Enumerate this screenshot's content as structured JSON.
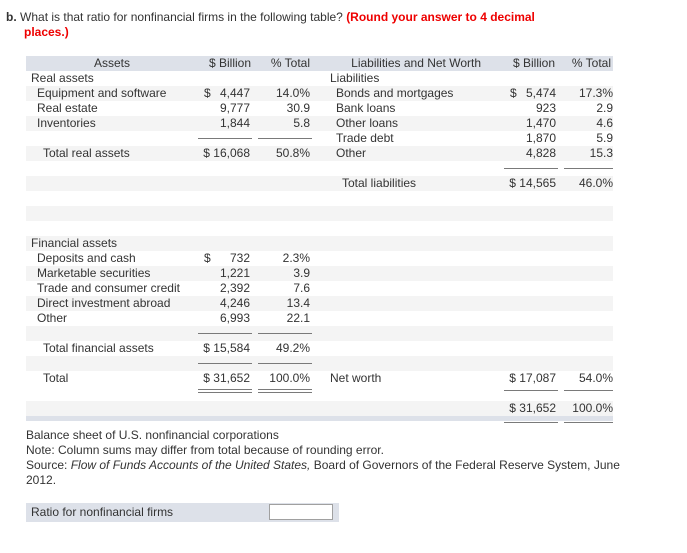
{
  "question": {
    "number": "b.",
    "text": "What is that ratio for nonfinancial firms in the following table?",
    "hint_line1": "(Round your answer to 4 decimal",
    "hint_line2": "places.)"
  },
  "table": {
    "headers": {
      "assets": "Assets",
      "assets_billion": "$ Billion",
      "assets_pct": "% Total",
      "liabilities": "Liabilities and Net Worth",
      "liab_billion": "$ Billion",
      "liab_pct": "% Total"
    },
    "real_assets": {
      "title": "Real assets",
      "items": [
        {
          "label": "Equipment and software",
          "dollar": "$",
          "value": "4,447",
          "pct": "14.0%"
        },
        {
          "label": "Real estate",
          "dollar": "",
          "value": "9,777",
          "pct": "30.9"
        },
        {
          "label": "Inventories",
          "dollar": "",
          "value": "1,844",
          "pct": "5.8"
        }
      ],
      "total": {
        "label": "Total real assets",
        "value": "$ 16,068",
        "pct": "50.8%"
      }
    },
    "liabilities": {
      "title": "Liabilities",
      "items": [
        {
          "label": "Bonds and mortgages",
          "dollar": "$",
          "value": "5,474",
          "pct": "17.3%"
        },
        {
          "label": "Bank loans",
          "dollar": "",
          "value": "923",
          "pct": "2.9"
        },
        {
          "label": "Other loans",
          "dollar": "",
          "value": "1,470",
          "pct": "4.6"
        },
        {
          "label": "Trade debt",
          "dollar": "",
          "value": "1,870",
          "pct": "5.9"
        },
        {
          "label": "Other",
          "dollar": "",
          "value": "4,828",
          "pct": "15.3"
        }
      ],
      "total": {
        "label": "Total liabilities",
        "value": "$ 14,565",
        "pct": "46.0%"
      }
    },
    "financial_assets": {
      "title": "Financial assets",
      "items": [
        {
          "label": "Deposits and cash",
          "dollar": "$",
          "value": "732",
          "pct": "2.3%"
        },
        {
          "label": "Marketable securities",
          "dollar": "",
          "value": "1,221",
          "pct": "3.9"
        },
        {
          "label": "Trade and consumer credit",
          "dollar": "",
          "value": "2,392",
          "pct": "7.6"
        },
        {
          "label": "Direct investment abroad",
          "dollar": "",
          "value": "4,246",
          "pct": "13.4"
        },
        {
          "label": "Other",
          "dollar": "",
          "value": "6,993",
          "pct": "22.1"
        }
      ],
      "total": {
        "label": "Total financial assets",
        "value": "$ 15,584",
        "pct": "49.2%"
      }
    },
    "total_assets": {
      "label": "Total",
      "value": "$ 31,652",
      "pct": "100.0%"
    },
    "net_worth": {
      "label": "Net worth",
      "value": "$ 17,087",
      "pct": "54.0%"
    },
    "total_liab_nw": {
      "value": "$ 31,652",
      "pct": "100.0%"
    }
  },
  "notes": {
    "caption": "Balance sheet of U.S. nonfinancial corporations",
    "note": "Note: Column sums may differ from total because of rounding error.",
    "source_prefix": "Source: ",
    "source_title": "Flow of Funds Accounts of the United States,",
    "source_rest": " Board of Governors of the Federal Reserve System, June 2012."
  },
  "answer": {
    "label": "Ratio for nonfinancial firms",
    "value": ""
  },
  "colors": {
    "hint_red": "#ee0000",
    "header_bg": "#dde1e9",
    "stripe_bg": "#f4f4f4"
  }
}
